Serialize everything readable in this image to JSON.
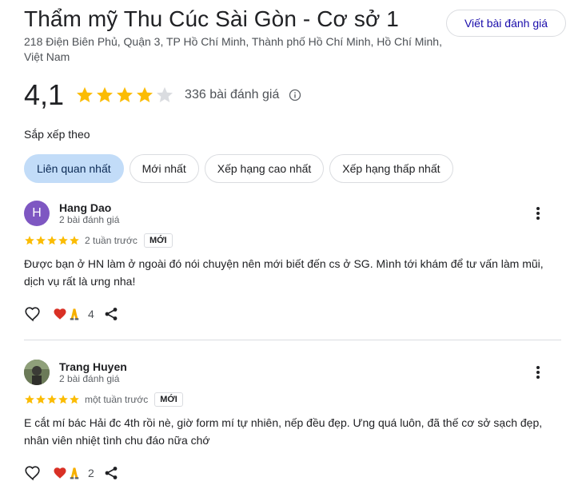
{
  "header": {
    "title": "Thẩm mỹ Thu Cúc Sài Gòn - Cơ sở 1",
    "address": "218 Điện Biên Phủ, Quận 3, TP Hồ Chí Minh, Thành phố Hồ Chí Minh, Hồ Chí Minh, Việt Nam",
    "write_review_label": "Viết bài đánh giá"
  },
  "rating": {
    "value": "4,1",
    "stars_filled": 4,
    "stars_total": 5,
    "review_count": "336 bài đánh giá"
  },
  "sort": {
    "label": "Sắp xếp theo",
    "options": [
      "Liên quan nhất",
      "Mới nhất",
      "Xếp hạng cao nhất",
      "Xếp hạng thấp nhất"
    ],
    "selected": "Liên quan nhất"
  },
  "reviews": [
    {
      "avatar_letter": "H",
      "name": "Hang Dao",
      "meta": "2 bài đánh giá",
      "stars": 5,
      "when": "2 tuần trước",
      "badge": "MỚI",
      "text": "Được bạn ở HN làm ở ngoài đó nói chuyện nên mới biết đến cs ở SG. Mình tới khám để tư vấn làm mũi, dịch vụ rất là ưng nha!",
      "reaction_count": "4"
    },
    {
      "avatar_letter": "",
      "name": "Trang Huyen",
      "meta": "2 bài đánh giá",
      "stars": 5,
      "when": "một tuần trước",
      "badge": "MỚI",
      "text": "E cắt mí bác Hải đc 4th rồi nè, giờ form mí tự nhiên, nếp đều đẹp. Ưng quá luôn, đã thế cơ sở sạch đẹp, nhân viên nhiệt tình chu đáo nữa chớ",
      "reaction_count": "2"
    }
  ],
  "colors": {
    "star": "#fbbc04",
    "star_empty": "#dadce0",
    "chip_active_bg": "#c2dcf8",
    "link": "#1a0dab"
  },
  "icons": [
    "star-icon",
    "info-icon",
    "more-vert-icon",
    "heart-outline-icon",
    "heart-reaction-icon",
    "pray-reaction-icon",
    "share-icon"
  ]
}
